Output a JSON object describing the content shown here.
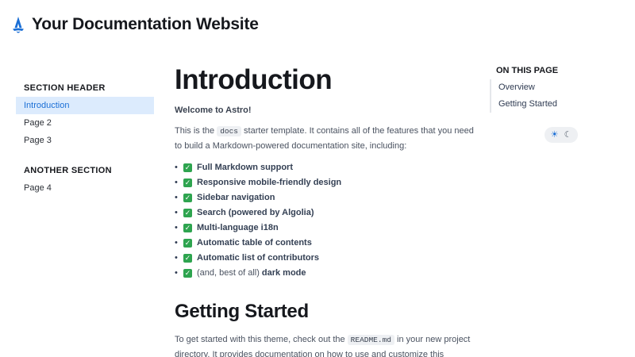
{
  "site": {
    "title": "Your Documentation Website"
  },
  "sidebar": {
    "sections": [
      {
        "header": "SECTION HEADER",
        "items": [
          {
            "label": "Introduction",
            "active": true
          },
          {
            "label": "Page 2",
            "active": false
          },
          {
            "label": "Page 3",
            "active": false
          }
        ]
      },
      {
        "header": "ANOTHER SECTION",
        "items": [
          {
            "label": "Page 4",
            "active": false
          }
        ]
      }
    ]
  },
  "main": {
    "title": "Introduction",
    "welcome": "Welcome to Astro!",
    "intro_before": "This is the ",
    "intro_code": "docs",
    "intro_after": " starter template. It contains all of the features that you need to build a Markdown-powered documentation site, including:",
    "features": [
      "Full Markdown support",
      "Responsive mobile-friendly design",
      "Sidebar navigation",
      "Search (powered by Algolia)",
      "Multi-language i18n",
      "Automatic table of contents",
      "Automatic list of contributors"
    ],
    "last_feature_prefix": "(and, best of all) ",
    "last_feature_bold": "dark mode",
    "getting_started_title": "Getting Started",
    "gs_before": "To get started with this theme, check out the ",
    "gs_code": "README.md",
    "gs_after": " in your new project directory. It provides documentation on how to use and customize this"
  },
  "toc": {
    "title": "ON THIS PAGE",
    "items": [
      "Overview",
      "Getting Started"
    ]
  },
  "theme_toggle": {
    "sun_icon": "☀",
    "moon_icon": "☾"
  },
  "colors": {
    "accent": "#1b6fd6",
    "active_bg": "#dcebfd",
    "check": "#2ea44f"
  }
}
